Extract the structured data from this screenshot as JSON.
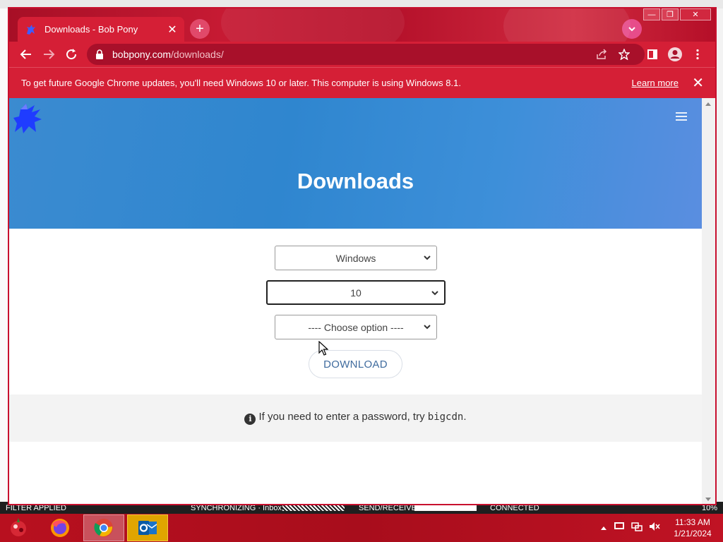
{
  "browser": {
    "tab_title": "Downloads - Bob Pony",
    "url_host": "bobpony.com",
    "url_path": "/downloads/",
    "infobar_text": "To get future Google Chrome updates, you'll need Windows 10 or later. This computer is using Windows 8.1.",
    "infobar_link": "Learn more"
  },
  "page": {
    "title": "Downloads",
    "os_select": "Windows",
    "version_select": "10",
    "option_select": "---- Choose option ----",
    "download_label": "DOWNLOAD",
    "note_text": "If you need to enter a password, try ",
    "note_code": "bigcdn",
    "note_end": "."
  },
  "outlook_status": {
    "filter": "FILTER APPLIED",
    "sync": "SYNCHRONIZING · Inbox",
    "send_receive": "SEND/RECEIVE",
    "connected": "CONNECTED",
    "zoom": "10%"
  },
  "taskbar": {
    "apps": [
      "firefox-icon",
      "chrome-icon",
      "outlook-icon"
    ],
    "time": "11:33 AM",
    "date": "1/21/2024"
  },
  "colors": {
    "chrome_accent": "#d51f36",
    "hero_blue": "#3b8bd0",
    "taskbar": "#b8101f"
  }
}
